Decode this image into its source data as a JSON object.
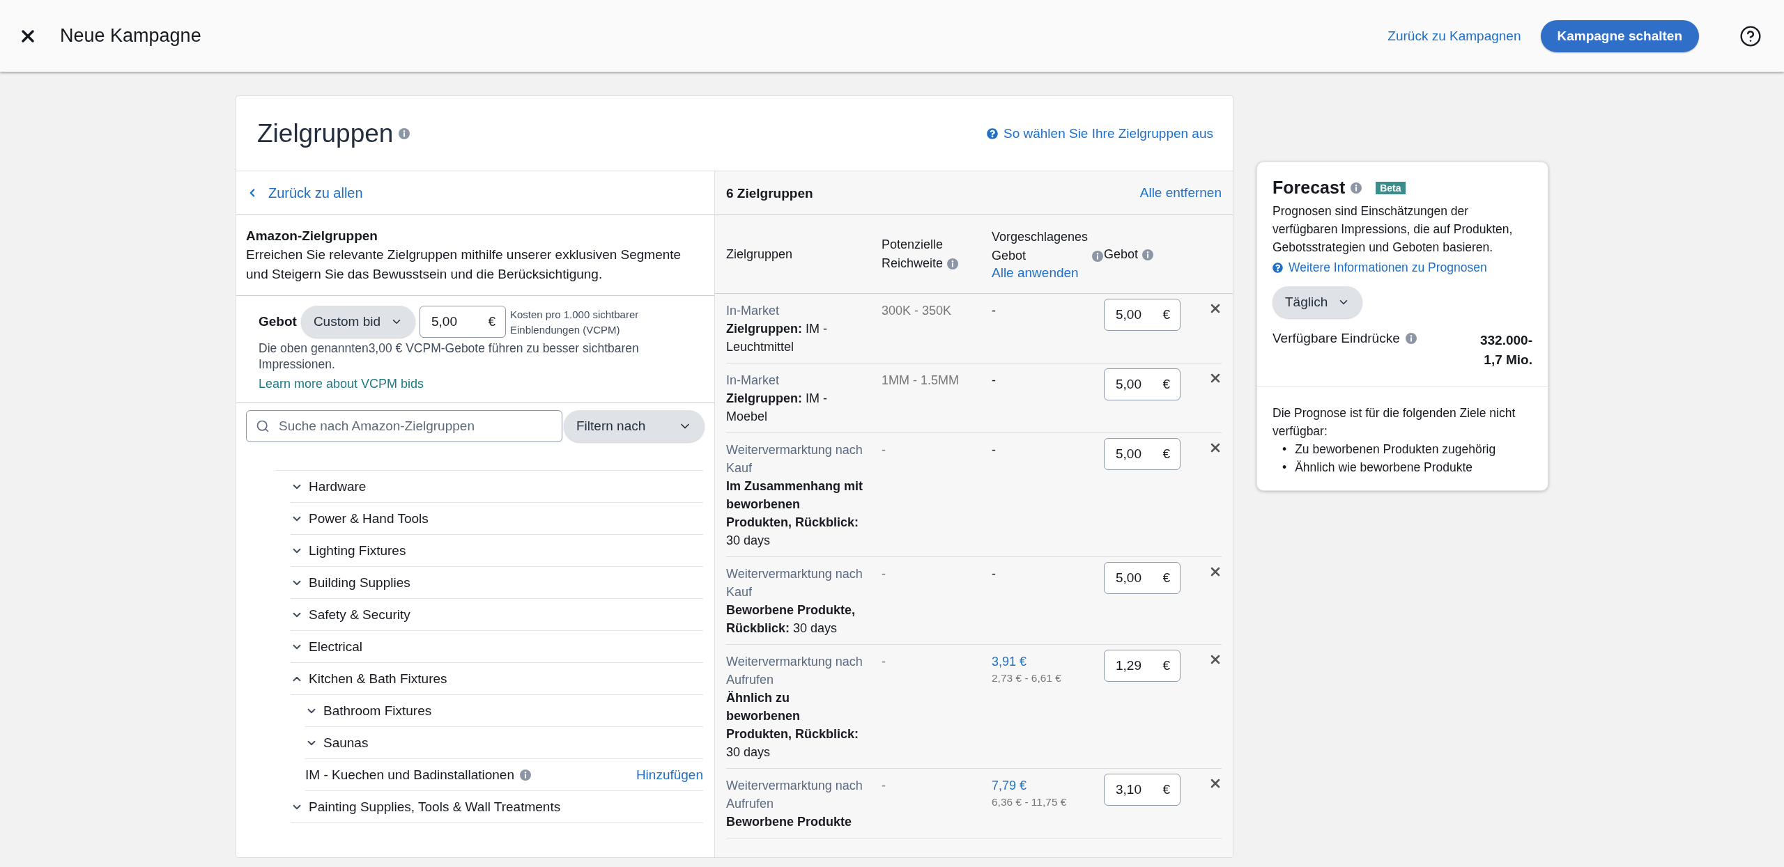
{
  "header": {
    "title": "Neue Kampagne",
    "back_link": "Zurück zu Kampagnen",
    "primary_button": "Kampagne schalten"
  },
  "card": {
    "title": "Zielgruppen",
    "help_link": "So wählen Sie Ihre Zielgruppen aus"
  },
  "left": {
    "back_link": "Zurück zu allen",
    "intro": {
      "title": "Amazon-Zielgruppen",
      "text": "Erreichen Sie relevante Zielgruppen mithilfe unserer exklusiven Segmente und Steigern Sie das Bewusstsein und die Berücksichtigung."
    },
    "bid": {
      "label": "Gebot",
      "mode": "Custom bid",
      "value": "5,00",
      "currency": "€",
      "unit": "Kosten pro 1.000 sichtbarer Einblendungen (VCPM)",
      "note": "Die oben genannten3,00 € VCPM-Gebote führen zu besser sichtbaren Impressionen.",
      "link": "Learn more about VCPM bids"
    },
    "search": {
      "placeholder": "Suche nach Amazon-Zielgruppen"
    },
    "filter": "Filtern nach",
    "tree": [
      {
        "kind": "group",
        "label": "Hardware",
        "expanded": false
      },
      {
        "kind": "group",
        "label": "Power & Hand Tools",
        "expanded": false
      },
      {
        "kind": "group",
        "label": "Lighting Fixtures",
        "expanded": false
      },
      {
        "kind": "group",
        "label": "Building Supplies",
        "expanded": false
      },
      {
        "kind": "group",
        "label": "Safety & Security",
        "expanded": false
      },
      {
        "kind": "group",
        "label": "Electrical",
        "expanded": false
      },
      {
        "kind": "group",
        "label": "Kitchen & Bath Fixtures",
        "expanded": true,
        "children": [
          {
            "kind": "group",
            "label": "Bathroom Fixtures",
            "expanded": false
          },
          {
            "kind": "group",
            "label": "Saunas",
            "expanded": false
          },
          {
            "kind": "audience",
            "label": "IM - Kuechen und Badinstallationen",
            "action": "Hinzufügen"
          }
        ]
      },
      {
        "kind": "group",
        "label": "Painting Supplies, Tools & Wall Treatments",
        "expanded": false
      }
    ]
  },
  "selected": {
    "count": "6 Zielgruppen",
    "remove_all": "Alle entfernen",
    "columns": [
      {
        "label": "Zielgruppen",
        "info": false
      },
      {
        "label": "Potenzielle Reichweite",
        "info": true
      },
      {
        "label": "Vorgeschlagenes Gebot",
        "info": true,
        "action": "Alle anwenden"
      },
      {
        "label": "Gebot",
        "info": true
      }
    ],
    "rows": [
      {
        "category": "In-Market",
        "detail": "**Zielgruppen:** IM - Leuchtmittel",
        "reach": "300K - 350K",
        "suggested": "-",
        "bid": "5,00",
        "currency": "€"
      },
      {
        "category": "In-Market",
        "detail": "**Zielgruppen:** IM - Moebel",
        "reach": "1MM - 1.5MM",
        "suggested": "-",
        "bid": "5,00",
        "currency": "€"
      },
      {
        "category": "Weitervermarktung nach Kauf",
        "detail": "**Im Zusammenhang mit beworbenen Produkten, Rückblick:** 30 days",
        "reach": "-",
        "suggested": "-",
        "bid": "5,00",
        "currency": "€"
      },
      {
        "category": "Weitervermarktung nach Kauf",
        "detail": "**Beworbene Produkte, Rückblick:** 30 days",
        "reach": "-",
        "suggested": "-",
        "bid": "5,00",
        "currency": "€"
      },
      {
        "category": "Weitervermarktung nach Aufrufen",
        "detail": "**Ähnlich zu beworbenen Produkten, Rückblick:** 30 days",
        "reach": "-",
        "suggested": "3,91 €",
        "suggested_range": "2,73 € - 6,61 €",
        "bid": "1,29",
        "currency": "€"
      },
      {
        "category": "Weitervermarktung nach Aufrufen",
        "detail": "**Beworbene Produkte**",
        "reach": "-",
        "suggested": "7,79 €",
        "suggested_range": "6,36 € - 11,75 €",
        "bid": "3,10",
        "currency": "€"
      }
    ]
  },
  "forecast": {
    "title": "Forecast",
    "badge": "Beta",
    "description": "Prognosen sind Einschätzungen der verfügbaren Impressions, die auf Produkten, Gebotsstrategien und Geboten basieren.",
    "link": "Weitere Informationen zu Prognosen",
    "period": "Täglich",
    "metric_label": "Verfügbare Eindrücke",
    "metric_value_lines": [
      "332.000-",
      "1,7 Mio."
    ],
    "note": "Die Prognose ist für die folgenden Ziele nicht verfügbar:",
    "unavailable": [
      {
        "marker": "•",
        "text": "Zu beworbenen Produkten zugehörig"
      },
      {
        "marker": "•",
        "text": "Ähnlich wie beworbene Produkte"
      }
    ]
  }
}
